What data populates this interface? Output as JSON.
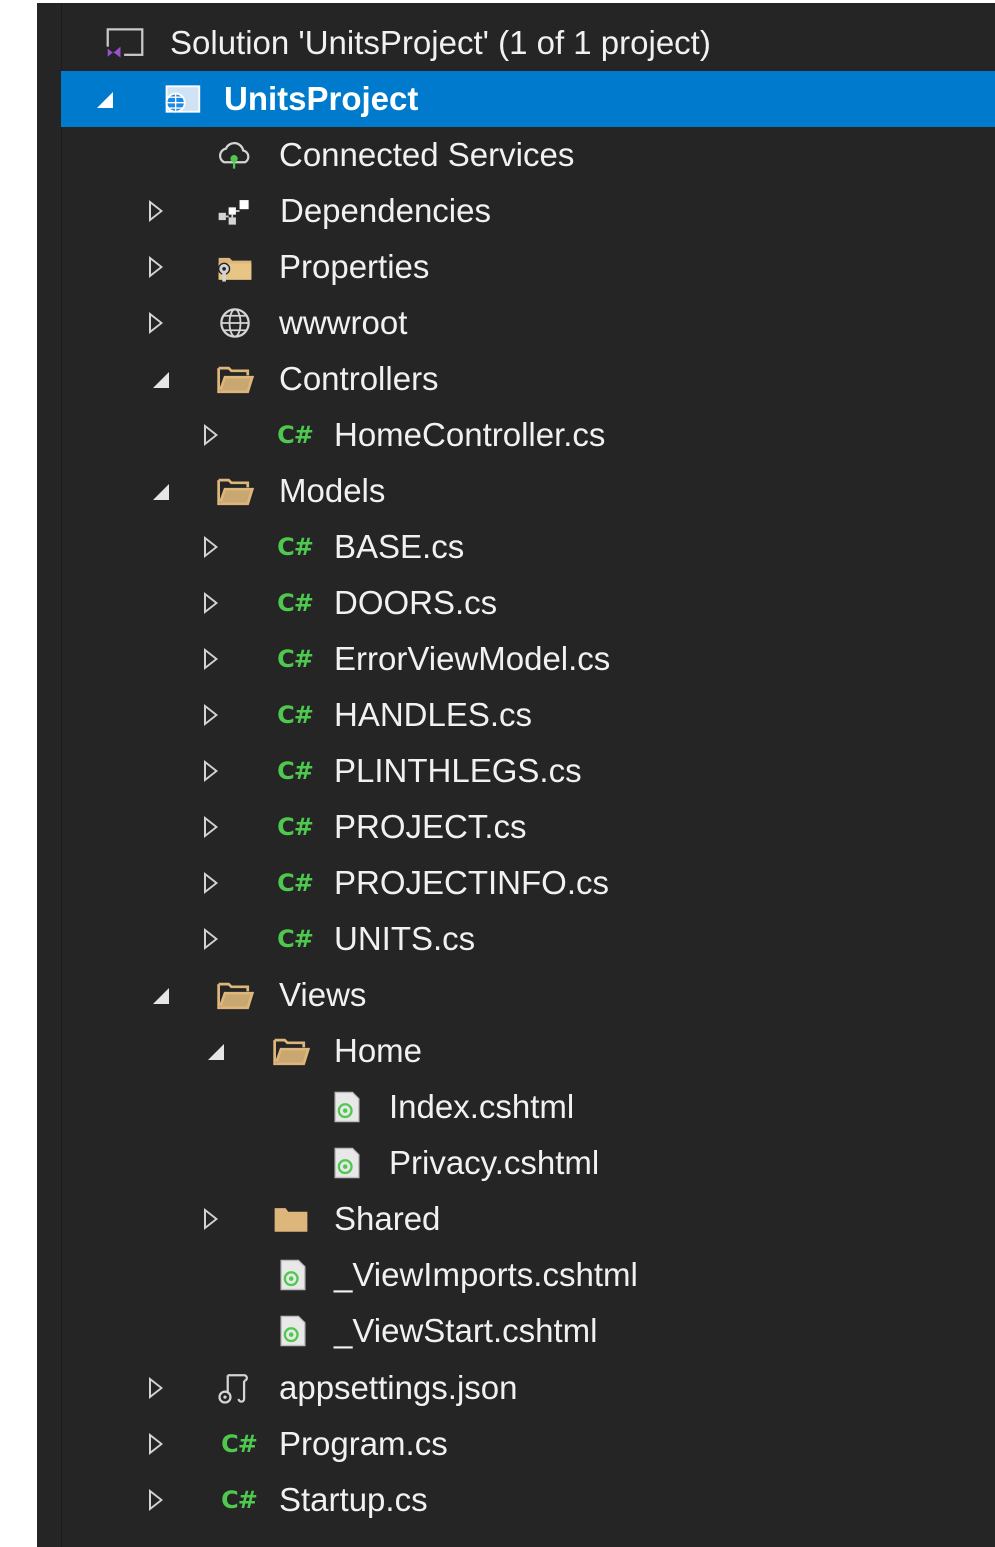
{
  "explorer": {
    "solution": {
      "label": "Solution 'UnitsProject' (1 of 1 project)",
      "icon": "visual-studio-solution-icon"
    },
    "project": {
      "label": "UnitsProject",
      "icon": "web-project-icon"
    },
    "items": {
      "connected_services": "Connected Services",
      "dependencies": "Dependencies",
      "properties": "Properties",
      "wwwroot": "wwwroot",
      "controllers": "Controllers",
      "home_controller": "HomeController.cs",
      "models": "Models",
      "base": "BASE.cs",
      "doors": "DOORS.cs",
      "error_view_model": "ErrorViewModel.cs",
      "handles": "HANDLES.cs",
      "plinthlegs": "PLINTHLEGS.cs",
      "project_cs": "PROJECT.cs",
      "projectinfo": "PROJECTINFO.cs",
      "units": "UNITS.cs",
      "views": "Views",
      "home": "Home",
      "index": "Index.cshtml",
      "privacy": "Privacy.cshtml",
      "shared": "Shared",
      "view_imports": "_ViewImports.cshtml",
      "view_start": "_ViewStart.cshtml",
      "appsettings": "appsettings.json",
      "program": "Program.cs",
      "startup": "Startup.cs"
    },
    "csharp_glyph": "C#",
    "colors": {
      "background": "#252526",
      "selection": "#007acc",
      "text": "#f1f1f1",
      "folder": "#dcb67a",
      "csharp": "#4ec94e"
    }
  }
}
